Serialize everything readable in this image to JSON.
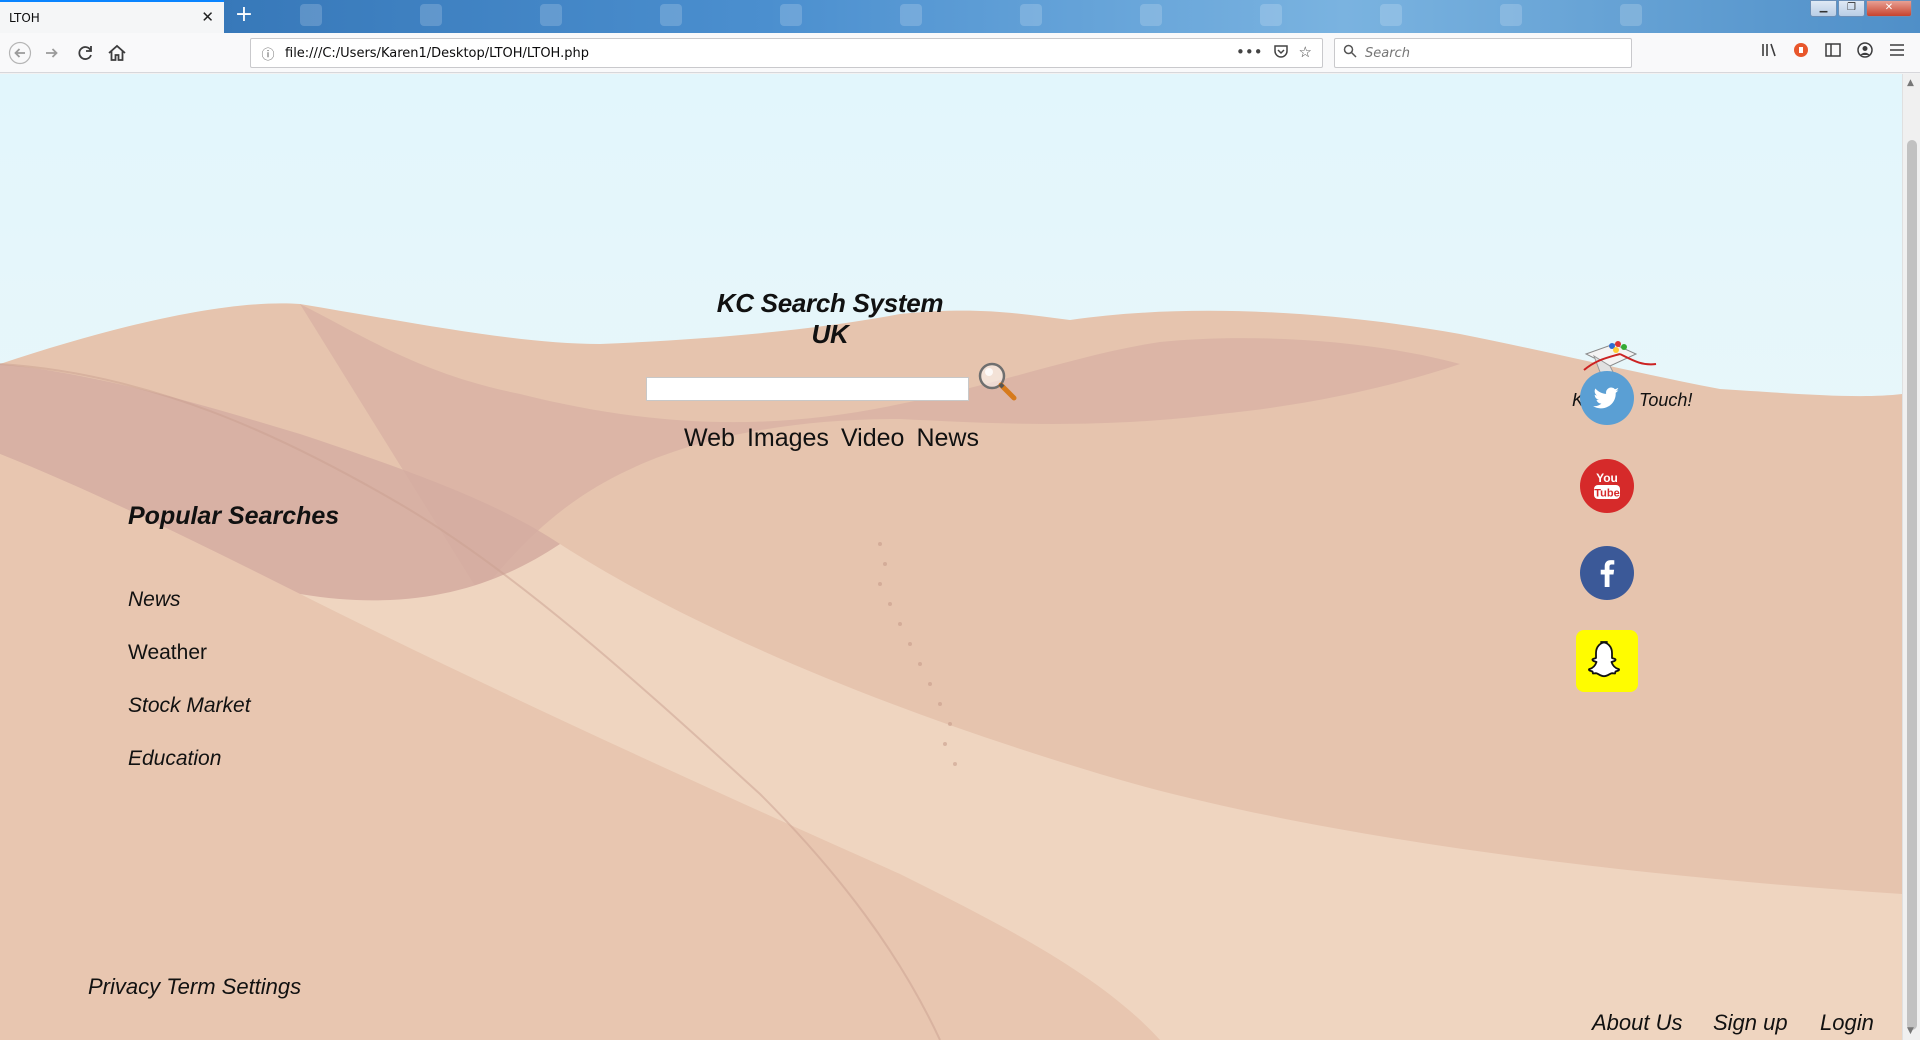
{
  "browser": {
    "tab_title": "LTOH",
    "tab_close": "✕",
    "new_tab": "+",
    "url": "file:///C:/Users/Karen1/Desktop/LTOH/LTOH.php",
    "search_placeholder": "Search",
    "page_actions": "•••"
  },
  "page": {
    "title": "KC Search System UK",
    "search_value": "",
    "tabs": [
      "Web",
      "Images",
      "Video",
      "News"
    ],
    "popular": {
      "heading": "Popular Searches",
      "items": [
        "News",
        "Weather",
        "Stock Market",
        "Education"
      ]
    },
    "keep_in_touch": "Keep In Touch!",
    "social": [
      {
        "name": "twitter-icon",
        "color": "#5a9fd4"
      },
      {
        "name": "youtube-icon",
        "color": "#d62a2a"
      },
      {
        "name": "facebook-icon",
        "color": "#3b5998"
      },
      {
        "name": "snapchat-icon",
        "color": "#fffc00"
      }
    ],
    "footer": {
      "privacy": "Privacy Term Settings",
      "about": "About Us",
      "signup": "Sign up",
      "login": "Login"
    }
  }
}
